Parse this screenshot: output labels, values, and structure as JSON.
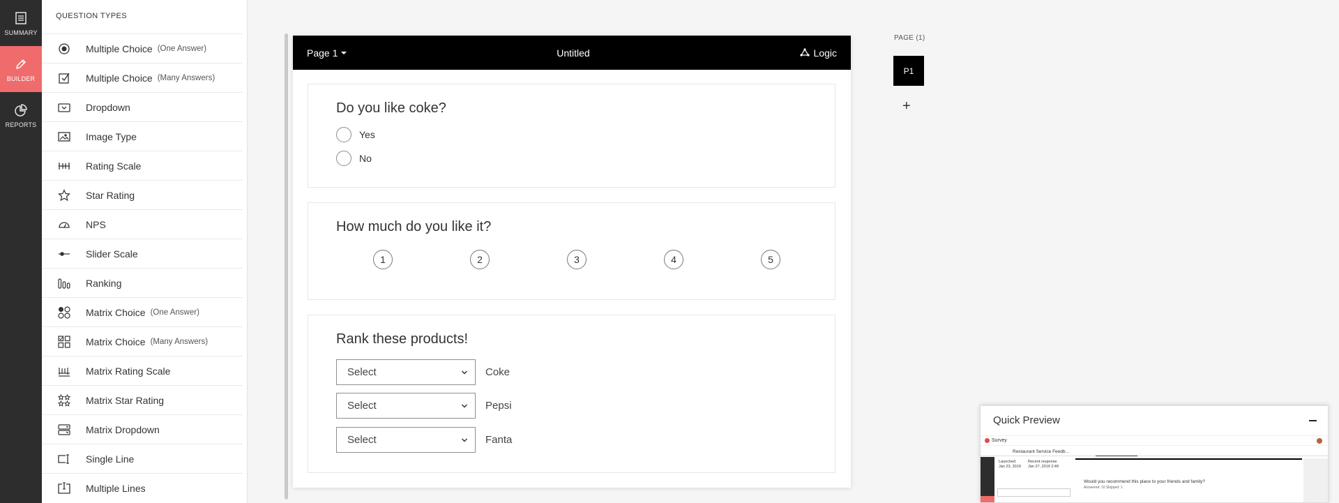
{
  "rail": {
    "items": [
      {
        "label": "SUMMARY"
      },
      {
        "label": "BUILDER"
      },
      {
        "label": "REPORTS"
      }
    ],
    "accent_color": "#f06b6b"
  },
  "question_types": {
    "title": "QUESTION TYPES",
    "items": [
      {
        "label": "Multiple Choice",
        "sub": "(One Answer)",
        "icon": "radio-icon"
      },
      {
        "label": "Multiple Choice",
        "sub": "(Many Answers)",
        "icon": "checkbox-icon"
      },
      {
        "label": "Dropdown",
        "sub": "",
        "icon": "dropdown-icon"
      },
      {
        "label": "Image Type",
        "sub": "",
        "icon": "image-icon"
      },
      {
        "label": "Rating Scale",
        "sub": "",
        "icon": "rating-scale-icon"
      },
      {
        "label": "Star Rating",
        "sub": "",
        "icon": "star-icon"
      },
      {
        "label": "NPS",
        "sub": "",
        "icon": "gauge-icon"
      },
      {
        "label": "Slider Scale",
        "sub": "",
        "icon": "slider-icon"
      },
      {
        "label": "Ranking",
        "sub": "",
        "icon": "ranking-icon"
      },
      {
        "label": "Matrix Choice",
        "sub": "(One Answer)",
        "icon": "matrix-radio-icon"
      },
      {
        "label": "Matrix Choice",
        "sub": "(Many Answers)",
        "icon": "matrix-checkbox-icon"
      },
      {
        "label": "Matrix Rating Scale",
        "sub": "",
        "icon": "matrix-scale-icon"
      },
      {
        "label": "Matrix Star Rating",
        "sub": "",
        "icon": "matrix-star-icon"
      },
      {
        "label": "Matrix Dropdown",
        "sub": "",
        "icon": "matrix-dropdown-icon"
      },
      {
        "label": "Single Line",
        "sub": "",
        "icon": "single-line-icon"
      },
      {
        "label": "Multiple Lines",
        "sub": "",
        "icon": "multiple-lines-icon"
      }
    ]
  },
  "form": {
    "page_menu_label": "Page 1",
    "title": "Untitled",
    "logic_label": "Logic",
    "questions": {
      "q1": {
        "title": "Do you like coke?",
        "options": [
          "Yes",
          "No"
        ]
      },
      "q2": {
        "title": "How much do you like it?",
        "scale": [
          "1",
          "2",
          "3",
          "4",
          "5"
        ]
      },
      "q3": {
        "title": "Rank these products!",
        "rows": [
          {
            "select": "Select",
            "label": "Coke"
          },
          {
            "select": "Select",
            "label": "Pepsi"
          },
          {
            "select": "Select",
            "label": "Fanta"
          }
        ]
      }
    }
  },
  "pages": {
    "label": "PAGE (1)",
    "items": [
      "P1"
    ],
    "add_label": "+"
  },
  "quick_preview": {
    "title": "Quick Preview",
    "mini": {
      "brand": "Survey",
      "survey_name": "Restaurant Service Feedb...",
      "launched_label": "Launched",
      "launched_value": "Jan 23, 2019",
      "recent_label": "Recent response",
      "recent_value": "Jan 27, 2019 2:49",
      "question": "Would you recommend this place to your friends and family?",
      "answered": "Answered: 10    Skipped: 1"
    }
  }
}
